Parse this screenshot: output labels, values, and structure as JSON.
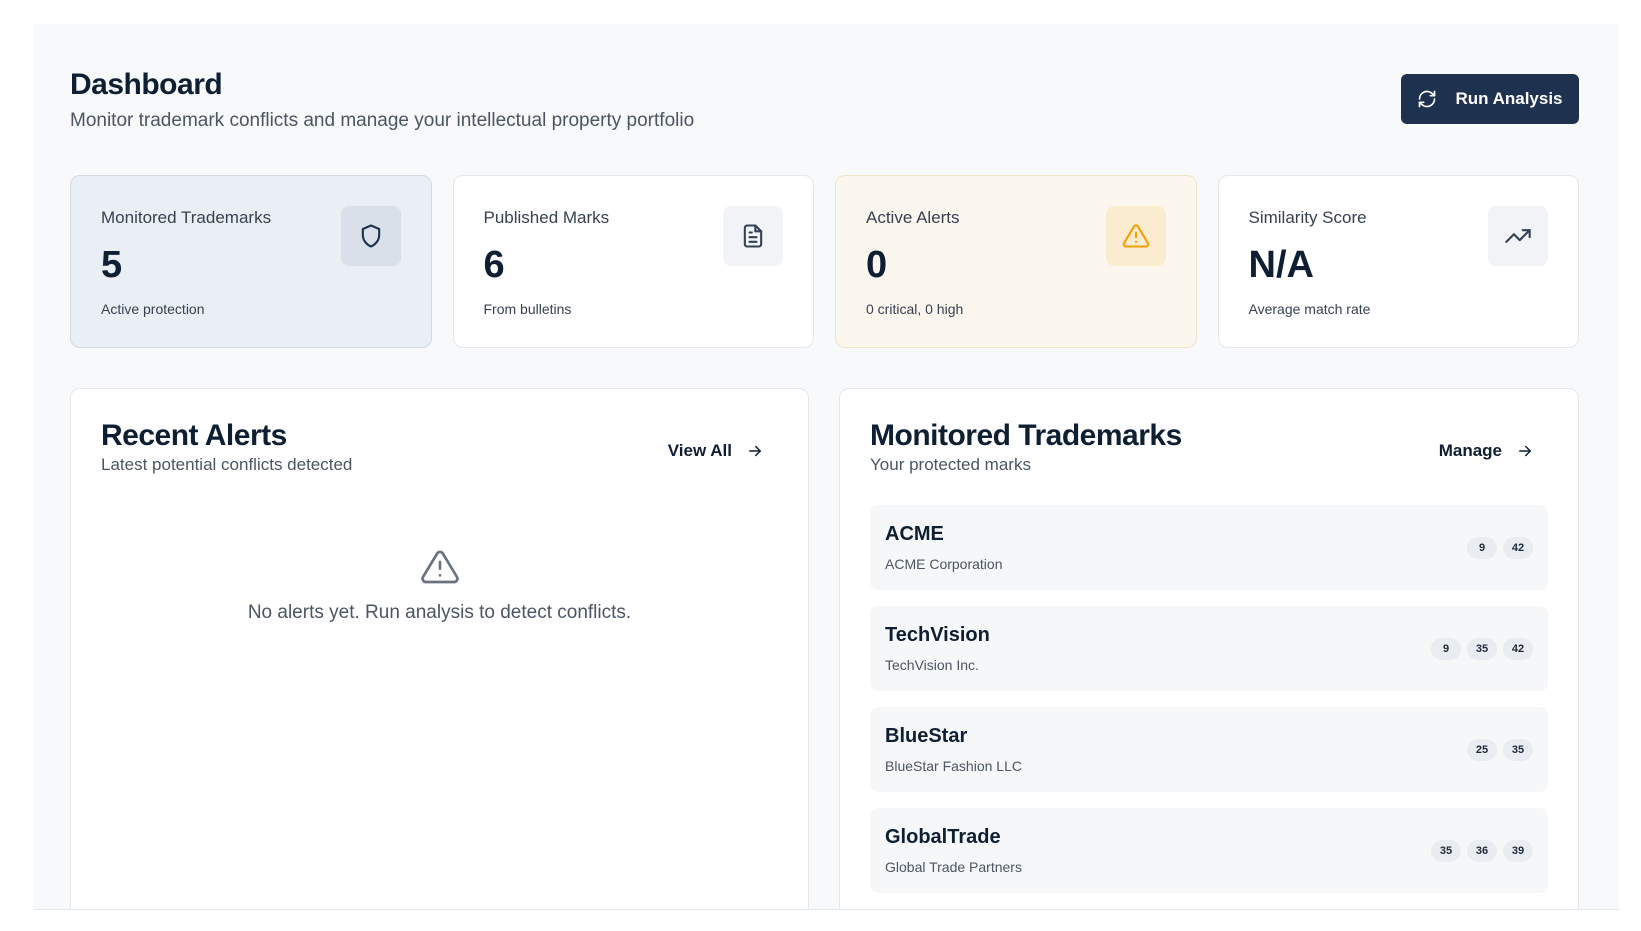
{
  "header": {
    "title": "Dashboard",
    "subtitle": "Monitor trademark conflicts and manage your intellectual property portfolio",
    "run_button": "Run Analysis"
  },
  "stats": [
    {
      "label": "Monitored Trademarks",
      "value": "5",
      "note": "Active protection",
      "icon": "shield-icon"
    },
    {
      "label": "Published Marks",
      "value": "6",
      "note": "From bulletins",
      "icon": "document-icon"
    },
    {
      "label": "Active Alerts",
      "value": "0",
      "note": "0 critical, 0 high",
      "icon": "warning-icon"
    },
    {
      "label": "Similarity Score",
      "value": "N/A",
      "note": "Average match rate",
      "icon": "trending-up-icon"
    }
  ],
  "alerts": {
    "title": "Recent Alerts",
    "subtitle": "Latest potential conflicts detected",
    "link": "View All",
    "empty_text": "No alerts yet. Run analysis to detect conflicts."
  },
  "trademarks": {
    "title": "Monitored Trademarks",
    "subtitle": "Your protected marks",
    "link": "Manage",
    "items": [
      {
        "name": "ACME",
        "owner": "ACME Corporation",
        "classes": [
          "9",
          "42"
        ]
      },
      {
        "name": "TechVision",
        "owner": "TechVision Inc.",
        "classes": [
          "9",
          "35",
          "42"
        ]
      },
      {
        "name": "BlueStar",
        "owner": "BlueStar Fashion LLC",
        "classes": [
          "25",
          "35"
        ]
      },
      {
        "name": "GlobalTrade",
        "owner": "Global Trade Partners",
        "classes": [
          "35",
          "36",
          "39"
        ]
      }
    ]
  },
  "colors": {
    "primary": "#1e3250",
    "amber_accent": "#f59e0b",
    "blue_card": "#eaeff5",
    "amber_card": "#fbf6ee"
  }
}
